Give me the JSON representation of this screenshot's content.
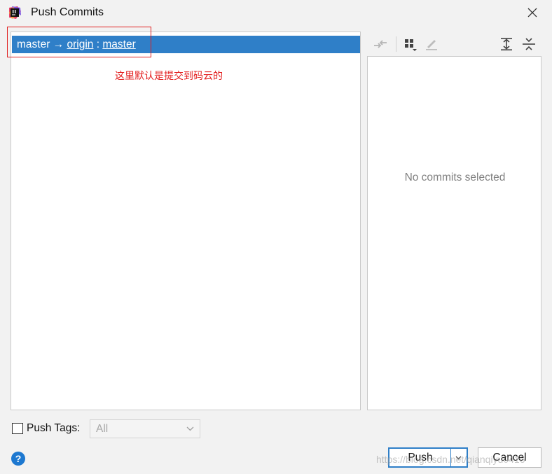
{
  "window": {
    "title": "Push Commits",
    "icons": {
      "app": "intellij-idea-icon",
      "close": "close-icon"
    }
  },
  "branch": {
    "local": "master",
    "arrow": "→",
    "remote": "origin",
    "separator": ":",
    "remote_branch": "master"
  },
  "annotation": {
    "text": "这里默认是提交到码云的",
    "color": "#e31e1e"
  },
  "toolbar": {
    "icons": [
      "merge-arrows-icon",
      "group-by-icon",
      "edit-pencil-icon",
      "expand-all-icon",
      "collapse-all-icon"
    ]
  },
  "details": {
    "empty_text": "No commits selected"
  },
  "tags": {
    "label": "Push Tags:",
    "select_value": "All",
    "checked": false
  },
  "footer": {
    "push_label": "Push",
    "cancel_label": "Cancel",
    "help_label": "?"
  },
  "watermark": "https://blog.csdn.net/qianqiyu0416",
  "colors": {
    "accent": "#2f7fc8",
    "annotation_box": "#e02020"
  }
}
